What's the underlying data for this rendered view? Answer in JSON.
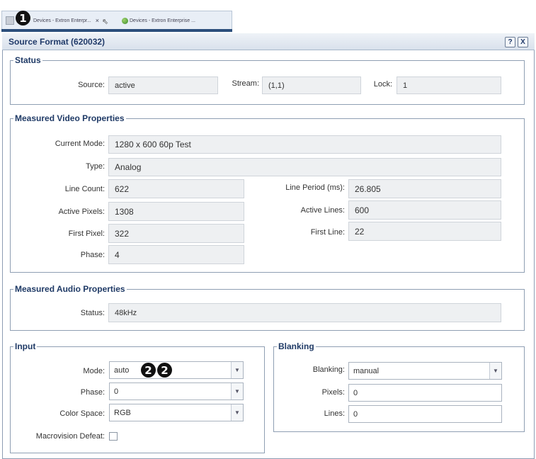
{
  "browser": {
    "tabs": [
      {
        "label": "Devices - Extron Enterpr...",
        "close": "×"
      },
      {
        "label": "Devices - Extron Enterprise ..."
      }
    ],
    "callout1": "1"
  },
  "dialog": {
    "title": "Source Format (620032)",
    "help": "?",
    "close": "X"
  },
  "status": {
    "legend": "Status",
    "source_label": "Source:",
    "source_value": "active",
    "stream_label": "Stream:",
    "stream_value": "(1,1)",
    "lock_label": "Lock:",
    "lock_value": "1"
  },
  "video": {
    "legend": "Measured Video Properties",
    "current_mode_label": "Current Mode:",
    "current_mode_value": "1280 x 600 60p Test",
    "type_label": "Type:",
    "type_value": "Analog",
    "line_count_label": "Line Count:",
    "line_count_value": "622",
    "line_period_label": "Line Period (ms):",
    "line_period_value": "26.805",
    "active_pixels_label": "Active Pixels:",
    "active_pixels_value": "1308",
    "active_lines_label": "Active Lines:",
    "active_lines_value": "600",
    "first_pixel_label": "First Pixel:",
    "first_pixel_value": "322",
    "first_line_label": "First Line:",
    "first_line_value": "22",
    "phase_label": "Phase:",
    "phase_value": "4"
  },
  "audio": {
    "legend": "Measured Audio Properties",
    "status_label": "Status:",
    "status_value": "48kHz"
  },
  "input": {
    "legend": "Input",
    "mode_label": "Mode:",
    "mode_value": "auto",
    "phase_label": "Phase:",
    "phase_value": "0",
    "color_space_label": "Color Space:",
    "color_space_value": "RGB",
    "macrovision_label": "Macrovision Defeat:",
    "callout2a": "2",
    "callout2b": "2"
  },
  "blanking": {
    "legend": "Blanking",
    "blanking_label": "Blanking:",
    "blanking_value": "manual",
    "pixels_label": "Pixels:",
    "pixels_value": "0",
    "lines_label": "Lines:",
    "lines_value": "0"
  },
  "icons": {
    "dropdown": "chevron-down-icon",
    "tab": "page-icon",
    "globe": "globe-icon"
  }
}
